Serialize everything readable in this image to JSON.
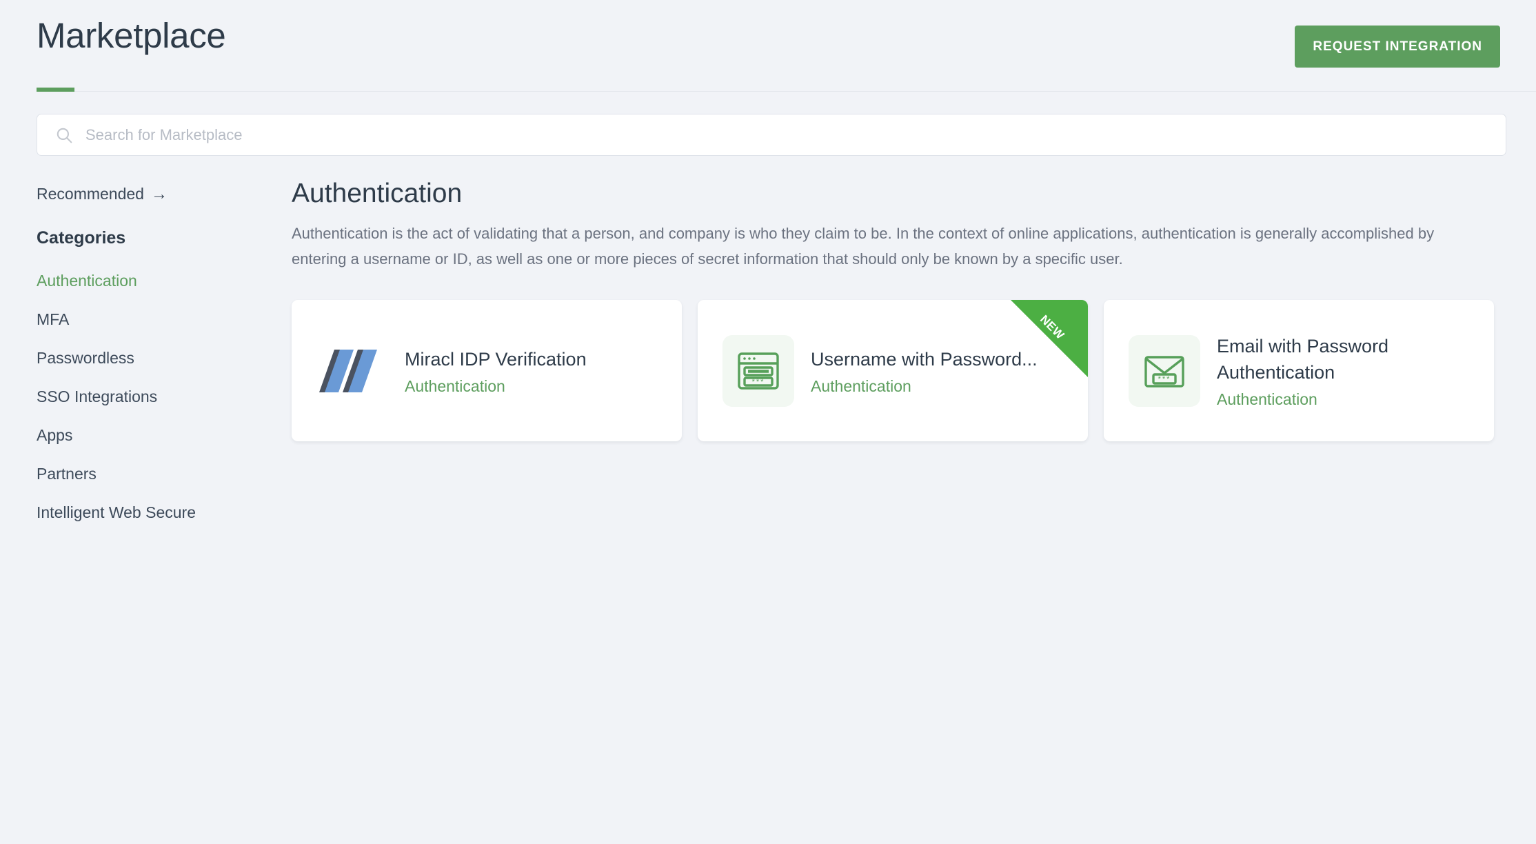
{
  "header": {
    "title": "Marketplace",
    "request_button": "REQUEST INTEGRATION",
    "accent_color": "#5d9e5e"
  },
  "search": {
    "placeholder": "Search for Marketplace",
    "value": "",
    "icon": "search-icon"
  },
  "sidebar": {
    "recommended_label": "Recommended",
    "recommended_arrow": "→",
    "categories_heading": "Categories",
    "categories": [
      {
        "label": "Authentication",
        "active": true
      },
      {
        "label": "MFA",
        "active": false
      },
      {
        "label": "Passwordless",
        "active": false
      },
      {
        "label": "SSO Integrations",
        "active": false
      },
      {
        "label": "Apps",
        "active": false
      },
      {
        "label": "Partners",
        "active": false
      },
      {
        "label": "Intelligent Web Secure",
        "active": false
      }
    ]
  },
  "main": {
    "section_title": "Authentication",
    "section_description": "Authentication is the act of validating that a person, and company is who they claim to be. In the context of online applications, authentication is generally accomplished by entering a username or ID, as well as one or more pieces of secret information that should only be known by a specific user.",
    "cards": [
      {
        "title": "Miracl IDP Verification",
        "category": "Authentication",
        "icon": "miracl-m-logo-icon",
        "badge": null
      },
      {
        "title": "Username with Password...",
        "category": "Authentication",
        "icon": "login-form-window-icon",
        "badge": "NEW"
      },
      {
        "title": "Email with Password Authentication",
        "category": "Authentication",
        "icon": "envelope-password-icon",
        "badge": null
      }
    ]
  },
  "colors": {
    "page_background": "#f1f3f7",
    "accent_green": "#5d9e5e",
    "ribbon_green": "#4caf43",
    "text_dark": "#2e3b49",
    "text_muted": "#6b7280",
    "logo_blue": "#6a9ad6",
    "logo_dark": "#4a5260"
  }
}
